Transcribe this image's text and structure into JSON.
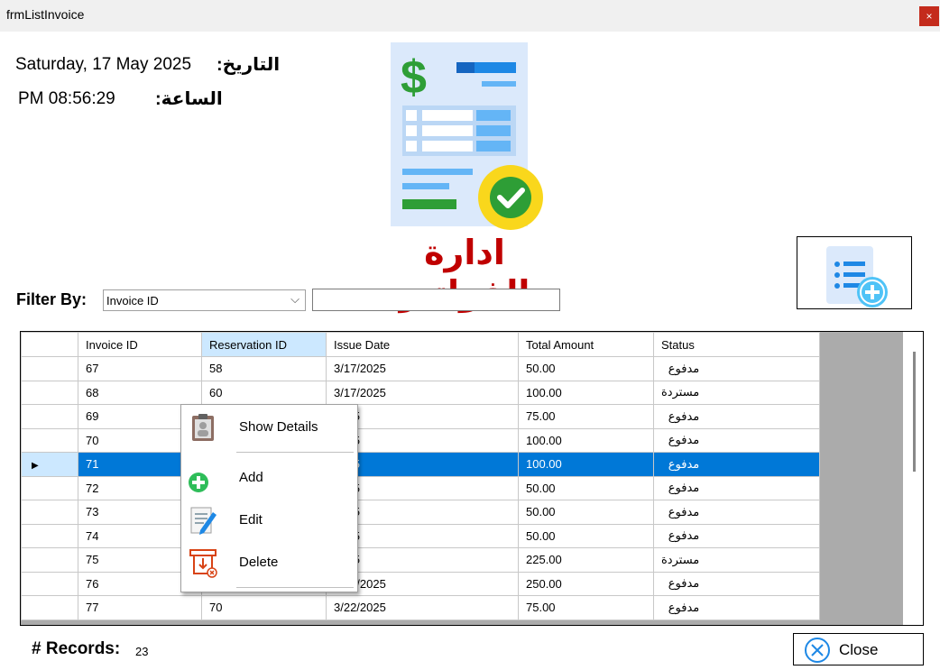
{
  "window": {
    "title": "frmListInvoice",
    "close_glyph": "×"
  },
  "header": {
    "date_label": "التاريخ:",
    "date_value": "Saturday, 17 May 2025",
    "time_label": "الساعة:",
    "time_value": "PM 08:56:29",
    "page_title": "ادارة الفواتير"
  },
  "filter": {
    "label": "Filter By:",
    "selected": "Invoice ID",
    "text_value": ""
  },
  "grid": {
    "columns": [
      "Invoice ID",
      "Reservation ID",
      "Issue Date",
      "Total Amount",
      "Status"
    ],
    "highlighted_column": "Reservation ID",
    "selected_row": 4,
    "rows": [
      [
        "67",
        "58",
        "3/17/2025",
        "50.00",
        "مدفوع"
      ],
      [
        "68",
        "60",
        "3/17/2025",
        "100.00",
        "مستردة"
      ],
      [
        "69",
        "",
        "2025",
        "75.00",
        "مدفوع"
      ],
      [
        "70",
        "",
        "2025",
        "100.00",
        "مدفوع"
      ],
      [
        "71",
        "",
        "2025",
        "100.00",
        "مدفوع"
      ],
      [
        "72",
        "",
        "2025",
        "50.00",
        "مدفوع"
      ],
      [
        "73",
        "",
        "2025",
        "50.00",
        "مدفوع"
      ],
      [
        "74",
        "",
        "2025",
        "50.00",
        "مدفوع"
      ],
      [
        "75",
        "",
        "2025",
        "225.00",
        "مستردة"
      ],
      [
        "76",
        "69",
        "3/22/2025",
        "250.00",
        "مدفوع"
      ],
      [
        "77",
        "70",
        "3/22/2025",
        "75.00",
        "مدفوع"
      ]
    ]
  },
  "context_menu": {
    "items": [
      {
        "label": "Show Details",
        "icon": "clipboard-icon"
      },
      {
        "label": "Add",
        "icon": "plus-circle-icon"
      },
      {
        "label": "Edit",
        "icon": "edit-document-icon"
      },
      {
        "label": "Delete",
        "icon": "delete-icon"
      }
    ]
  },
  "footer": {
    "records_label": "# Records:",
    "records_count": "23",
    "close_label": "Close"
  },
  "colors": {
    "title_red": "#c00000",
    "selection_blue": "#0078d7",
    "header_highlight": "#cce8ff",
    "close_red": "#c42b1c"
  }
}
